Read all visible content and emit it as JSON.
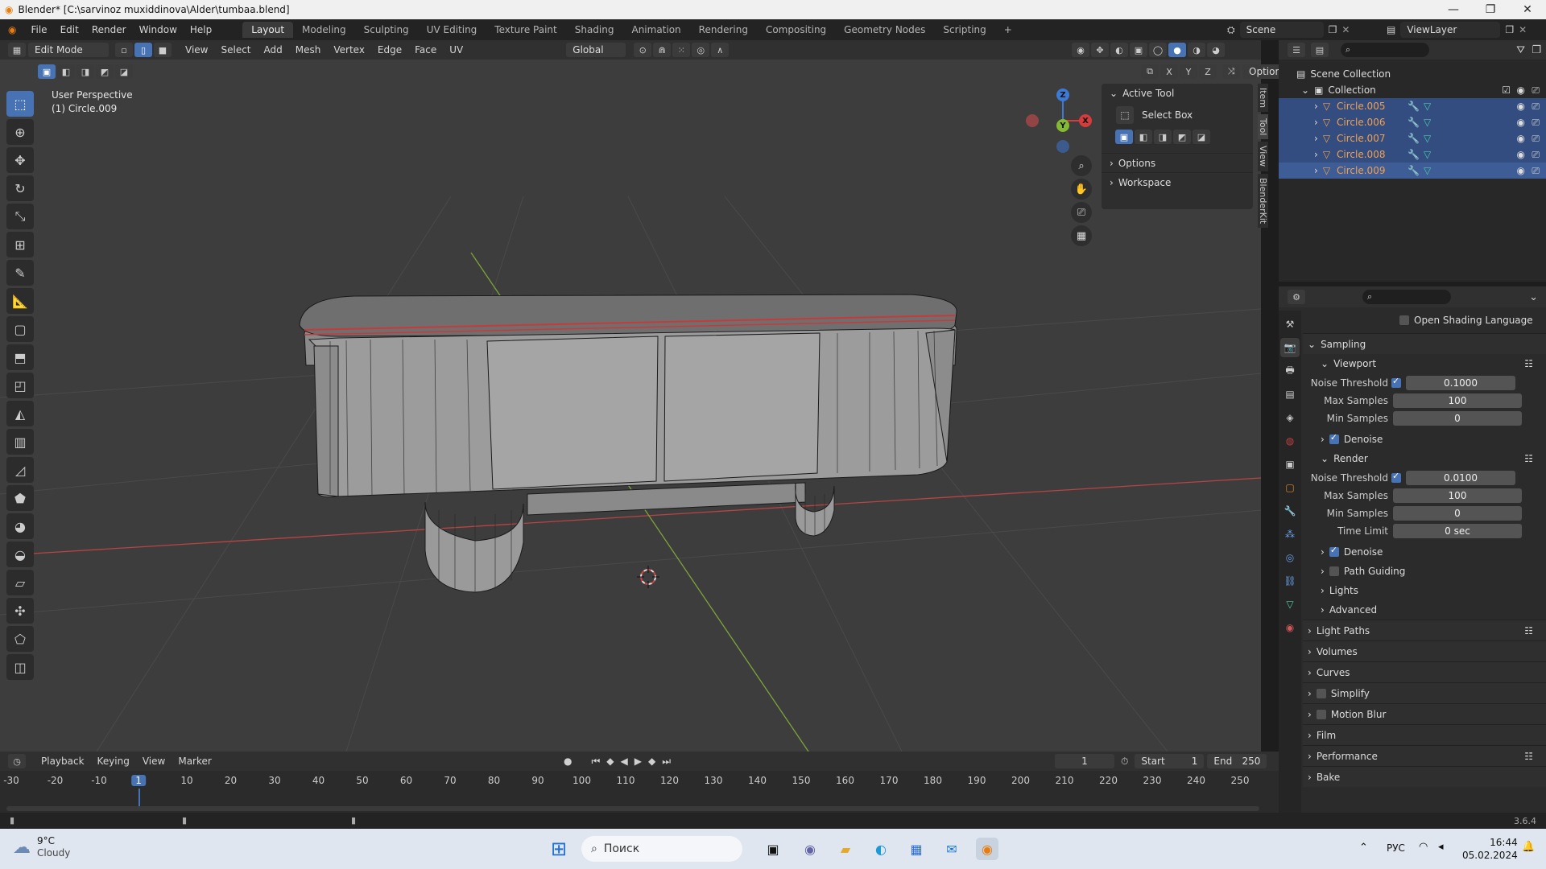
{
  "window": {
    "title": "Blender* [C:\\sarvinoz muxiddinova\\Alder\\tumbaa.blend]",
    "controls": [
      "—",
      "❐",
      "✕"
    ]
  },
  "topmenu": {
    "items": [
      "File",
      "Edit",
      "Render",
      "Window",
      "Help"
    ],
    "workspaces": [
      "Layout",
      "Modeling",
      "Sculpting",
      "UV Editing",
      "Texture Paint",
      "Shading",
      "Animation",
      "Rendering",
      "Compositing",
      "Geometry Nodes",
      "Scripting",
      "+"
    ],
    "active_workspace": "Layout",
    "scene": "Scene",
    "view_layer": "ViewLayer"
  },
  "viewport_header": {
    "mode": "Edit Mode",
    "menus": [
      "View",
      "Select",
      "Add",
      "Mesh",
      "Vertex",
      "Edge",
      "Face",
      "UV"
    ],
    "orientation": "Global",
    "options_label": "Options",
    "axes": [
      "X",
      "Y",
      "Z"
    ]
  },
  "viewport": {
    "perspective": "User Perspective",
    "object": "(1) Circle.009",
    "gizmo": {
      "x": "X",
      "y": "Y",
      "z": "Z"
    }
  },
  "tool_panel": {
    "header": "Active Tool",
    "tool_name": "Select Box",
    "sections": [
      "Options",
      "Workspace"
    ],
    "tabs": [
      "Item",
      "Tool",
      "View",
      "BlenderKit"
    ]
  },
  "outliner": {
    "scene_collection": "Scene Collection",
    "collection": "Collection",
    "objects": [
      "Circle.005",
      "Circle.006",
      "Circle.007",
      "Circle.008",
      "Circle.009"
    ]
  },
  "properties": {
    "osl": "Open Shading Language",
    "sampling": "Sampling",
    "viewport": {
      "label": "Viewport",
      "noise_threshold_label": "Noise Threshold",
      "noise_threshold": "0.1000",
      "max_samples_label": "Max Samples",
      "max_samples": "100",
      "min_samples_label": "Min Samples",
      "min_samples": "0",
      "denoise": "Denoise"
    },
    "render": {
      "label": "Render",
      "noise_threshold_label": "Noise Threshold",
      "noise_threshold": "0.0100",
      "max_samples_label": "Max Samples",
      "max_samples": "100",
      "min_samples_label": "Min Samples",
      "min_samples": "0",
      "time_limit_label": "Time Limit",
      "time_limit": "0 sec",
      "denoise": "Denoise",
      "path_guiding": "Path Guiding",
      "lights": "Lights",
      "advanced": "Advanced"
    },
    "sections": [
      "Light Paths",
      "Volumes",
      "Curves",
      "Simplify",
      "Motion Blur",
      "Film",
      "Performance",
      "Bake"
    ]
  },
  "timeline": {
    "menus": [
      "Playback",
      "Keying",
      "View",
      "Marker"
    ],
    "current_frame": "1",
    "start_label": "Start",
    "start": "1",
    "end_label": "End",
    "end": "250",
    "ruler": [
      "-30",
      "-20",
      "-10",
      "1",
      "10",
      "20",
      "30",
      "40",
      "50",
      "60",
      "70",
      "80",
      "90",
      "100",
      "110",
      "120",
      "130",
      "140",
      "150",
      "160",
      "170",
      "180",
      "190",
      "200",
      "210",
      "220",
      "230",
      "240",
      "250"
    ]
  },
  "status": {
    "version": "3.6.4"
  },
  "taskbar": {
    "weather_temp": "9°C",
    "weather_desc": "Cloudy",
    "search_placeholder": "Поиск",
    "lang": "РУС",
    "time": "16:44",
    "date": "05.02.2024"
  },
  "colors": {
    "accent": "#4772b3",
    "object_orange": "#f0a050",
    "x_axis": "#d63c3c",
    "y_axis": "#84b934",
    "z_axis": "#3c7ad6"
  }
}
